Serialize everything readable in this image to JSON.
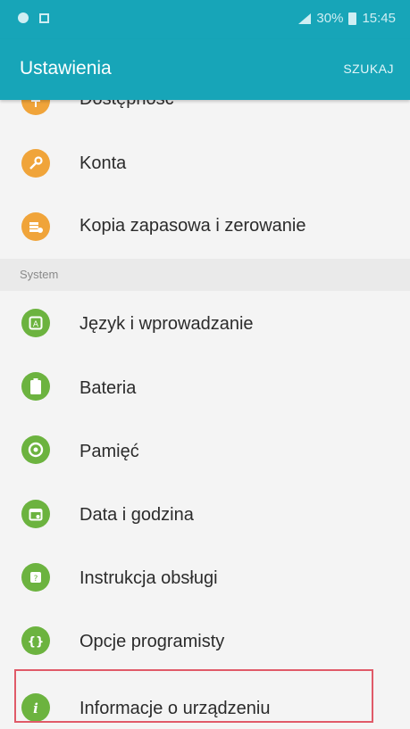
{
  "status_bar": {
    "battery_percent": "30%",
    "time": "15:45"
  },
  "app_bar": {
    "title": "Ustawienia",
    "search_label": "SZUKAJ"
  },
  "items_top": [
    {
      "label": "Dostępność",
      "icon": "accessibility-icon"
    },
    {
      "label": "Konta",
      "icon": "key-icon"
    },
    {
      "label": "Kopia zapasowa i zerowanie",
      "icon": "backup-icon"
    }
  ],
  "section": {
    "label": "System"
  },
  "items_system": [
    {
      "label": "Język i wprowadzanie",
      "icon": "language-icon"
    },
    {
      "label": "Bateria",
      "icon": "battery-icon"
    },
    {
      "label": "Pamięć",
      "icon": "storage-icon"
    },
    {
      "label": "Data i godzina",
      "icon": "calendar-icon"
    },
    {
      "label": "Instrukcja obsługi",
      "icon": "manual-icon"
    },
    {
      "label": "Opcje programisty",
      "icon": "developer-icon"
    },
    {
      "label": "Informacje o urządzeniu",
      "icon": "info-icon"
    }
  ],
  "colors": {
    "accent": "#17a5b8",
    "orange_icon": "#f0a43a",
    "green_icon": "#6cb33f",
    "highlight": "#e05a68"
  }
}
